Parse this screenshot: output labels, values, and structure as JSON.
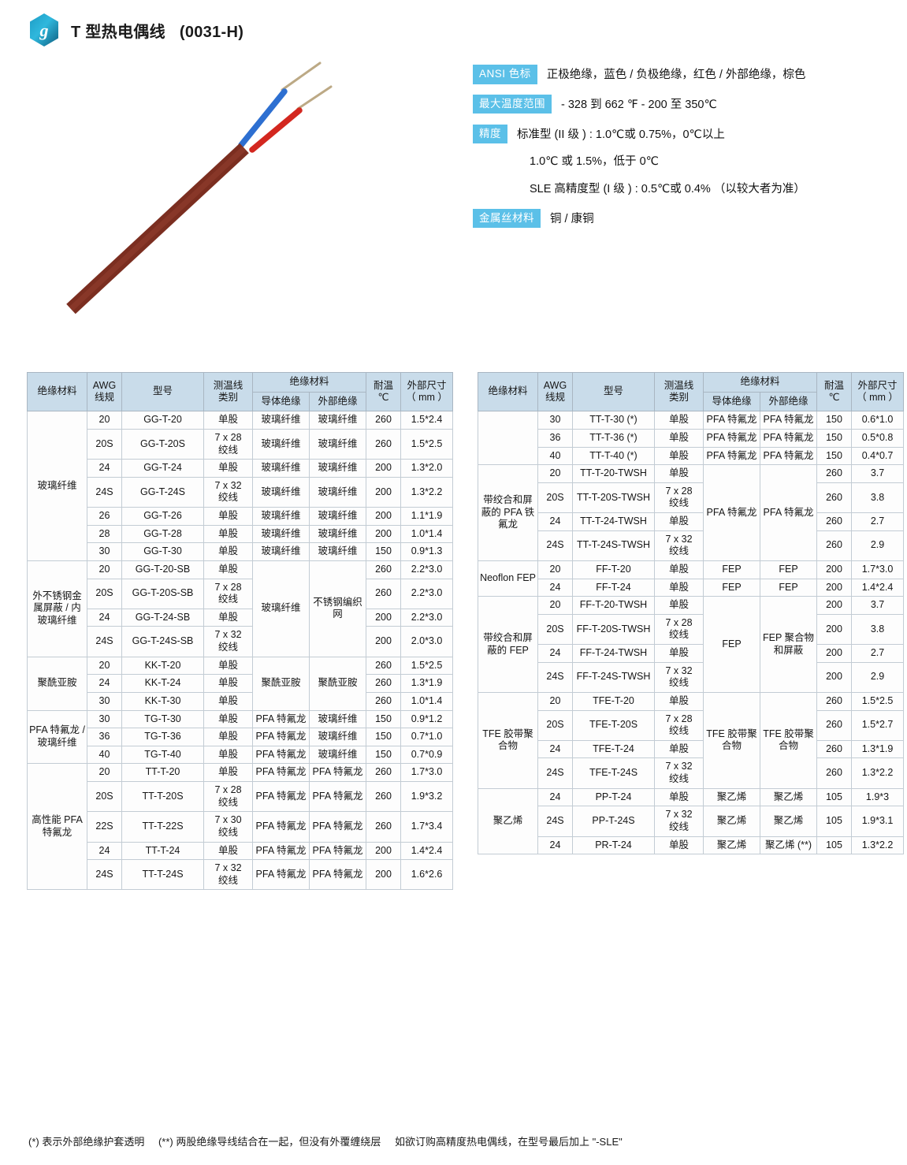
{
  "header": {
    "logo_alt": "hexagon-logo",
    "title": "T 型热电偶线",
    "code": "(0031-H)"
  },
  "product_image": {
    "alt": "T 型热电偶线 cable photo",
    "jacket_color": "#7B2E20",
    "positive_wire_color": "#2D6FD1",
    "negative_wire_color": "#D3271F",
    "conductor_color": "#BCA985"
  },
  "specs": [
    {
      "badge": "ANSI 色标",
      "value": "正极绝缘，蓝色 / 负极绝缘，红色 / 外部绝缘，棕色"
    },
    {
      "badge": "最大温度范围",
      "value": "- 328 到 662 ℉    - 200 至 350℃"
    },
    {
      "badge": "精度",
      "value": "标准型 (II 级 ) : 1.0℃或 0.75%，0℃以上",
      "extra": [
        "1.0℃ 或 1.5%，低于 0℃",
        "SLE 高精度型 (I 级 ) : 0.5℃或 0.4%   （以较大者为准）"
      ]
    },
    {
      "badge": "金属丝材料",
      "value": "铜 / 康铜"
    }
  ],
  "table_headers": {
    "insulation_material": "绝缘材料",
    "awg": "AWG",
    "awg_sub": "线规",
    "model": "型号",
    "wire_type": "测温线",
    "wire_type_sub": "类别",
    "insulation_group": "绝缘材料",
    "conductor_insulation": "导体绝缘",
    "outer_insulation": "外部绝缘",
    "temp": "耐温",
    "temp_unit": "℃",
    "dimension": "外部尺寸",
    "dimension_unit": "（ mm ）"
  },
  "left_table": {
    "groups": [
      {
        "material": "玻璃纤维",
        "rows": [
          {
            "awg": "20",
            "model": "GG-T-20",
            "type": "单股",
            "ins1": "玻璃纤维",
            "ins2": "玻璃纤维",
            "temp": "260",
            "dim": "1.5*2.4"
          },
          {
            "awg": "20S",
            "model": "GG-T-20S",
            "type": "7 x 28\n绞线",
            "ins1": "玻璃纤维",
            "ins2": "玻璃纤维",
            "temp": "260",
            "dim": "1.5*2.5"
          },
          {
            "awg": "24",
            "model": "GG-T-24",
            "type": "单股",
            "ins1": "玻璃纤维",
            "ins2": "玻璃纤维",
            "temp": "200",
            "dim": "1.3*2.0"
          },
          {
            "awg": "24S",
            "model": "GG-T-24S",
            "type": "7 x 32\n绞线",
            "ins1": "玻璃纤维",
            "ins2": "玻璃纤维",
            "temp": "200",
            "dim": "1.3*2.2"
          },
          {
            "awg": "26",
            "model": "GG-T-26",
            "type": "单股",
            "ins1": "玻璃纤维",
            "ins2": "玻璃纤维",
            "temp": "200",
            "dim": "1.1*1.9"
          },
          {
            "awg": "28",
            "model": "GG-T-28",
            "type": "单股",
            "ins1": "玻璃纤维",
            "ins2": "玻璃纤维",
            "temp": "200",
            "dim": "1.0*1.4"
          },
          {
            "awg": "30",
            "model": "GG-T-30",
            "type": "单股",
            "ins1": "玻璃纤维",
            "ins2": "玻璃纤维",
            "temp": "150",
            "dim": "0.9*1.3"
          }
        ]
      },
      {
        "material": "外不锈钢金属屏蔽 / 内玻璃纤维",
        "merged_ins1": "玻璃纤维",
        "merged_ins2": "不锈钢编织网",
        "rows": [
          {
            "awg": "20",
            "model": "GG-T-20-SB",
            "type": "单股",
            "temp": "260",
            "dim": "2.2*3.0"
          },
          {
            "awg": "20S",
            "model": "GG-T-20S-SB",
            "type": "7 x 28\n绞线",
            "temp": "260",
            "dim": "2.2*3.0"
          },
          {
            "awg": "24",
            "model": "GG-T-24-SB",
            "type": "单股",
            "temp": "200",
            "dim": "2.2*3.0"
          },
          {
            "awg": "24S",
            "model": "GG-T-24S-SB",
            "type": "7 x 32\n绞线",
            "temp": "200",
            "dim": "2.0*3.0"
          }
        ]
      },
      {
        "material": "聚酰亚胺",
        "merged_ins1": "聚酰亚胺",
        "merged_ins2": "聚酰亚胺",
        "rows": [
          {
            "awg": "20",
            "model": "KK-T-20",
            "type": "单股",
            "temp": "260",
            "dim": "1.5*2.5"
          },
          {
            "awg": "24",
            "model": "KK-T-24",
            "type": "单股",
            "temp": "260",
            "dim": "1.3*1.9"
          },
          {
            "awg": "30",
            "model": "KK-T-30",
            "type": "单股",
            "temp": "260",
            "dim": "1.0*1.4"
          }
        ]
      },
      {
        "material": "PFA 特氟龙 / 玻璃纤维",
        "rows": [
          {
            "awg": "30",
            "model": "TG-T-30",
            "type": "单股",
            "ins1": "PFA 特氟龙",
            "ins1_blue": true,
            "ins2": "玻璃纤维",
            "temp": "150",
            "dim": "0.9*1.2"
          },
          {
            "awg": "36",
            "model": "TG-T-36",
            "type": "单股",
            "ins1": "PFA 特氟龙",
            "ins2": "玻璃纤维",
            "temp": "150",
            "dim": "0.7*1.0"
          },
          {
            "awg": "40",
            "model": "TG-T-40",
            "type": "单股",
            "ins1": "PFA 特氟龙",
            "ins2": "玻璃纤维",
            "temp": "150",
            "dim": "0.7*0.9"
          }
        ]
      },
      {
        "material": "高性能 PFA 特氟龙",
        "rows": [
          {
            "awg": "20",
            "model": "TT-T-20",
            "type": "单股",
            "ins1": "PFA 特氟龙",
            "ins2": "PFA 特氟龙",
            "temp": "260",
            "dim": "1.7*3.0"
          },
          {
            "awg": "20S",
            "model": "TT-T-20S",
            "type": "7 x 28\n绞线",
            "ins1": "PFA 特氟龙",
            "ins2": "PFA 特氟龙",
            "temp": "260",
            "dim": "1.9*3.2"
          },
          {
            "awg": "22S",
            "model": "TT-T-22S",
            "type": "7 x 30\n绞线",
            "ins1": "PFA 特氟龙",
            "ins2": "PFA 特氟龙",
            "temp": "260",
            "dim": "1.7*3.4"
          },
          {
            "awg": "24",
            "model": "TT-T-24",
            "type": "单股",
            "ins1": "PFA 特氟龙",
            "ins2": "PFA 特氟龙",
            "temp": "200",
            "dim": "1.4*2.4"
          },
          {
            "awg": "24S",
            "model": "TT-T-24S",
            "type": "7 x 32\n绞线",
            "ins1": "PFA 特氟龙",
            "ins2": "PFA 特氟龙",
            "temp": "200",
            "dim": "1.6*2.6"
          }
        ]
      }
    ]
  },
  "right_table": {
    "groups": [
      {
        "material": "",
        "rows": [
          {
            "awg": "30",
            "model": "TT-T-30 (*)",
            "type": "单股",
            "ins1": "PFA 特氟龙",
            "ins2": "PFA 特氟龙",
            "temp": "150",
            "dim": "0.6*1.0"
          },
          {
            "awg": "36",
            "model": "TT-T-36 (*)",
            "type": "单股",
            "ins1": "PFA 特氟龙",
            "ins2": "PFA 特氟龙",
            "temp": "150",
            "dim": "0.5*0.8"
          },
          {
            "awg": "40",
            "model": "TT-T-40 (*)",
            "type": "单股",
            "ins1": "PFA 特氟龙",
            "ins2": "PFA 特氟龙",
            "temp": "150",
            "dim": "0.4*0.7"
          }
        ]
      },
      {
        "material": "带绞合和屏蔽的 PFA 铁氟龙",
        "merged_ins1": "PFA 特氟龙",
        "merged_ins2": "PFA 特氟龙",
        "rows": [
          {
            "awg": "20",
            "model": "TT-T-20-TWSH",
            "type": "单股",
            "temp": "260",
            "dim": "3.7"
          },
          {
            "awg": "20S",
            "model": "TT-T-20S-TWSH",
            "type": "7 x 28\n绞线",
            "temp": "260",
            "dim": "3.8"
          },
          {
            "awg": "24",
            "model": "TT-T-24-TWSH",
            "type": "单股",
            "temp": "260",
            "dim": "2.7"
          },
          {
            "awg": "24S",
            "model": "TT-T-24S-TWSH",
            "type": "7 x 32\n绞线",
            "temp": "260",
            "dim": "2.9"
          }
        ]
      },
      {
        "material": "Neoflon FEP",
        "rows": [
          {
            "awg": "20",
            "model": "FF-T-20",
            "type": "单股",
            "ins1": "FEP",
            "ins2": "FEP",
            "temp": "200",
            "dim": "1.7*3.0"
          },
          {
            "awg": "24",
            "model": "FF-T-24",
            "type": "单股",
            "ins1": "FEP",
            "ins2": "FEP",
            "temp": "200",
            "dim": "1.4*2.4"
          }
        ]
      },
      {
        "material": "带绞合和屏蔽的 FEP",
        "merged_ins1": "FEP",
        "merged_ins2": "FEP 聚合物和屏蔽",
        "rows": [
          {
            "awg": "20",
            "model": "FF-T-20-TWSH",
            "type": "单股",
            "temp": "200",
            "dim": "3.7"
          },
          {
            "awg": "20S",
            "model": "FF-T-20S-TWSH",
            "type": "7 x 28\n绞线",
            "temp": "200",
            "dim": "3.8"
          },
          {
            "awg": "24",
            "model": "FF-T-24-TWSH",
            "type": "单股",
            "temp": "200",
            "dim": "2.7"
          },
          {
            "awg": "24S",
            "model": "FF-T-24S-TWSH",
            "type": "7 x 32\n绞线",
            "temp": "200",
            "dim": "2.9"
          }
        ]
      },
      {
        "material": "TFE 胶带聚合物",
        "merged_ins1": "TFE 胶带聚合物",
        "merged_ins2": "TFE 胶带聚合物",
        "rows": [
          {
            "awg": "20",
            "model": "TFE-T-20",
            "type": "单股",
            "temp": "260",
            "dim": "1.5*2.5"
          },
          {
            "awg": "20S",
            "model": "TFE-T-20S",
            "type": "7 x 28\n绞线",
            "temp": "260",
            "dim": "1.5*2.7"
          },
          {
            "awg": "24",
            "model": "TFE-T-24",
            "type": "单股",
            "temp": "260",
            "dim": "1.3*1.9"
          },
          {
            "awg": "24S",
            "model": "TFE-T-24S",
            "type": "7 x 32\n绞线",
            "temp": "260",
            "dim": "1.3*2.2"
          }
        ]
      },
      {
        "material": "聚乙烯",
        "rows": [
          {
            "awg": "24",
            "model": "PP-T-24",
            "type": "单股",
            "ins1": "聚乙烯",
            "ins2": "聚乙烯",
            "temp": "105",
            "dim": "1.9*3"
          },
          {
            "awg": "24S",
            "model": "PP-T-24S",
            "type": "7 x 32\n绞线",
            "ins1": "聚乙烯",
            "ins2": "聚乙烯",
            "temp": "105",
            "dim": "1.9*3.1"
          },
          {
            "awg": "24",
            "model": "PR-T-24",
            "type": "单股",
            "ins1": "聚乙烯",
            "ins2": "聚乙烯 (**)",
            "temp": "105",
            "dim": "1.3*2.2"
          }
        ]
      }
    ]
  },
  "footnote": {
    "note1": "(*) 表示外部绝缘护套透明",
    "note2": "(**) 两股绝缘导线结合在一起，但没有外覆缠绕层",
    "note3": "如欲订购高精度热电偶线，在型号最后加上 \"-SLE\""
  },
  "colors": {
    "badge_blue": "#5BC0E8",
    "table_header": "#C9DCEA",
    "table_border": "#c3ccd4",
    "blue_text": "#1f4fa8"
  }
}
